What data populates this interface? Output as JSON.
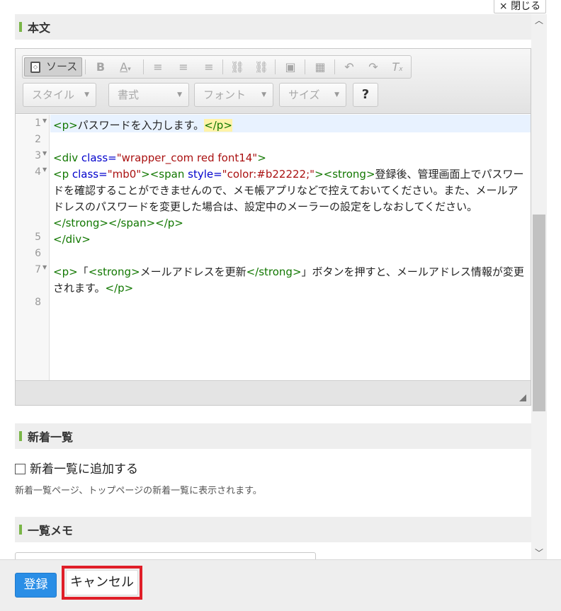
{
  "window": {
    "close_label": "× 閉じる"
  },
  "sections": {
    "body_title": "本文",
    "news_title": "新着一覧",
    "memo_title": "一覧メモ"
  },
  "toolbar": {
    "source_label": "ソース",
    "bold": "B",
    "font_color": "A",
    "style_placeholder": "スタイル",
    "format_placeholder": "書式",
    "font_placeholder": "フォント",
    "size_placeholder": "サイズ",
    "help": "?"
  },
  "code": {
    "line_numbers": [
      "1",
      "2",
      "3",
      "4",
      "5",
      "6",
      "7",
      "8"
    ]
  },
  "news": {
    "checkbox_label": "新着一覧に追加する",
    "help_text": "新着一覧ページ、トップページの新着一覧に表示されます。"
  },
  "footer": {
    "save_label": "登録",
    "cancel_label": "キャンセル"
  }
}
